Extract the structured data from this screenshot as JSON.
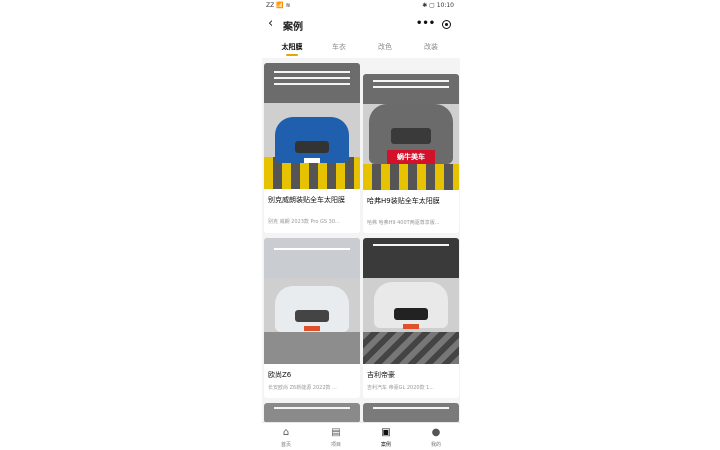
{
  "statusbar": {
    "left": "ZZ 📶 ≋",
    "right": "✱ ▢ 10:10"
  },
  "navbar": {
    "back": "‹",
    "title": "案例",
    "more": "•••"
  },
  "tabs": [
    {
      "label": "太阳膜",
      "active": true
    },
    {
      "label": "车衣",
      "active": false
    },
    {
      "label": "改色",
      "active": false
    },
    {
      "label": "改装",
      "active": false
    }
  ],
  "cases": [
    {
      "title": "别克威朗装贴全车太阳膜",
      "subtitle": "别克 威朗 2023款 Pro GS 30...",
      "car_color": "#1f5fae",
      "sign": ""
    },
    {
      "title": "哈弗H9装贴全车太阳膜",
      "subtitle": "哈弗 哈弗H9 400T两驱尊享版...",
      "car_color": "#6b6b6b",
      "sign": "蜗牛美车"
    },
    {
      "title": "欧尚Z6",
      "subtitle": "长安欧尚 Z6新能源 2022款 ...",
      "car_color": "#e9ecef",
      "sign": ""
    },
    {
      "title": "吉利帝豪",
      "subtitle": "吉利汽车 帝豪GL 2020款 1...",
      "car_color": "#e9e9e9",
      "sign": ""
    }
  ],
  "tabbar": [
    {
      "icon": "home-icon",
      "glyph": "⌂",
      "label": "首页"
    },
    {
      "icon": "list-icon",
      "glyph": "▤",
      "label": "项目"
    },
    {
      "icon": "case-icon",
      "glyph": "▣",
      "label": "案例"
    },
    {
      "icon": "user-icon",
      "glyph": "●",
      "label": "我的"
    }
  ]
}
